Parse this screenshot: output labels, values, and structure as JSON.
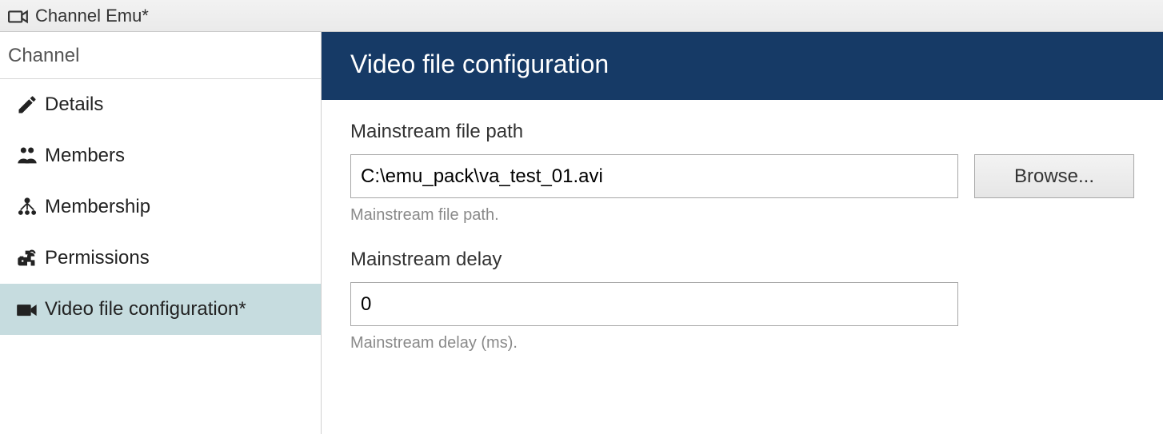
{
  "titlebar": {
    "icon": "camera-icon",
    "title": "Channel Emu*"
  },
  "sidebar": {
    "header": "Channel",
    "items": [
      {
        "icon": "edit-icon",
        "label": "Details",
        "selected": false
      },
      {
        "icon": "members-icon",
        "label": "Members",
        "selected": false
      },
      {
        "icon": "membership-icon",
        "label": "Membership",
        "selected": false
      },
      {
        "icon": "permissions-icon",
        "label": "Permissions",
        "selected": false
      },
      {
        "icon": "camera-icon",
        "label": "Video file configuration*",
        "selected": true
      }
    ]
  },
  "main": {
    "header": "Video file configuration",
    "fields": {
      "mainstream_path": {
        "label": "Mainstream file path",
        "value": "C:\\emu_pack\\va_test_01.avi",
        "browse_label": "Browse...",
        "help": "Mainstream file path."
      },
      "mainstream_delay": {
        "label": "Mainstream delay",
        "value": "0",
        "help": "Mainstream delay (ms)."
      }
    }
  }
}
